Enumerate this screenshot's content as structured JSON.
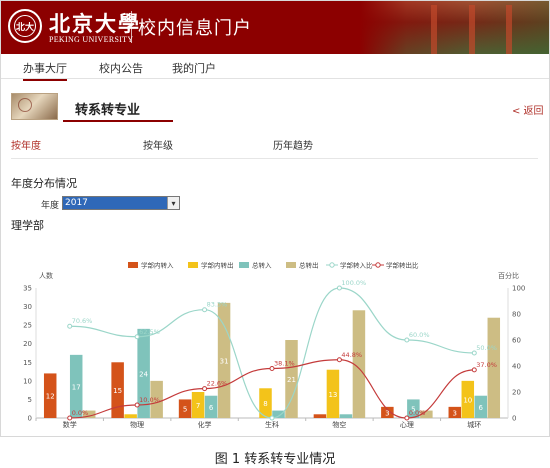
{
  "header": {
    "logo_cn": "北京大學",
    "logo_en": "PEKING UNIVERSITY",
    "emblem_text": "北大",
    "portal_title": "校内信息门户"
  },
  "nav": {
    "tabs": [
      {
        "label": "办事大厅",
        "active": true
      },
      {
        "label": "校内公告",
        "active": false
      },
      {
        "label": "我的门户",
        "active": false
      }
    ]
  },
  "page": {
    "title": "转系转专业",
    "back_label": "< 返回",
    "subtabs": [
      {
        "label": "按年度",
        "active": true
      },
      {
        "label": "按年级",
        "active": false
      },
      {
        "label": "历年趋势",
        "active": false
      }
    ],
    "section_title": "年度分布情况",
    "year_label": "年度",
    "year_value": "2017",
    "dept_title": "理学部"
  },
  "colors": {
    "brand": "#8c0000",
    "s1": "#d4531a",
    "s2": "#f3c31a",
    "s3": "#7fc3bb",
    "s4": "#cdbd84",
    "s5": "#9bd6c9",
    "s6": "#c43b3b"
  },
  "chart_data": {
    "type": "bar",
    "left_axis_label": "人数",
    "right_axis_label": "百分比",
    "categories": [
      "数学",
      "物理",
      "化学",
      "生科",
      "物空",
      "心理",
      "城环"
    ],
    "left_ylim": [
      0,
      35
    ],
    "left_ticks": [
      "0",
      "5",
      "10",
      "15",
      "20",
      "25",
      "30",
      "35"
    ],
    "right_ylim": [
      0,
      100
    ],
    "right_ticks": [
      "0",
      "20",
      "40",
      "60",
      "80",
      "100"
    ],
    "series": [
      {
        "name": "学部内转入",
        "type": "bar",
        "values": [
          12,
          15,
          5,
          0,
          1,
          3,
          3
        ],
        "labels": [
          "12",
          "15",
          "5",
          "",
          "",
          "3",
          "3"
        ]
      },
      {
        "name": "学部内转出",
        "type": "bar",
        "values": [
          0,
          1,
          7,
          8,
          13,
          0,
          10
        ],
        "labels": [
          "",
          "",
          "7",
          "8",
          "13",
          "",
          "10"
        ]
      },
      {
        "name": "总转入",
        "type": "bar",
        "values": [
          17,
          24,
          6,
          2,
          1,
          5,
          6
        ],
        "labels": [
          "17",
          "24",
          "6",
          "",
          "",
          "5",
          "6"
        ]
      },
      {
        "name": "总转出",
        "type": "bar",
        "values": [
          2,
          10,
          31,
          21,
          29,
          2,
          27
        ],
        "labels": [
          "",
          "",
          "31",
          "21",
          "",
          "",
          ""
        ]
      },
      {
        "name": "学部转入比",
        "type": "line",
        "axis": "right",
        "values": [
          70.6,
          62.5,
          83.3,
          0.0,
          100.0,
          60.0,
          50.0
        ],
        "labels": [
          "70.6%",
          "62.5%",
          "83.3%",
          "",
          "100.0%",
          "60.0%",
          "50.0%"
        ]
      },
      {
        "name": "学部转出比",
        "type": "line",
        "axis": "right",
        "values": [
          0.0,
          10.0,
          22.6,
          38.1,
          44.8,
          0.0,
          37.0
        ],
        "labels": [
          "0.0%",
          "10.0%",
          "22.6%",
          "38.1%",
          "44.8%",
          "0.0%",
          "37.0%"
        ]
      }
    ],
    "legend_position": "top-center",
    "grid": false
  },
  "caption": "图 1   转系转专业情况"
}
